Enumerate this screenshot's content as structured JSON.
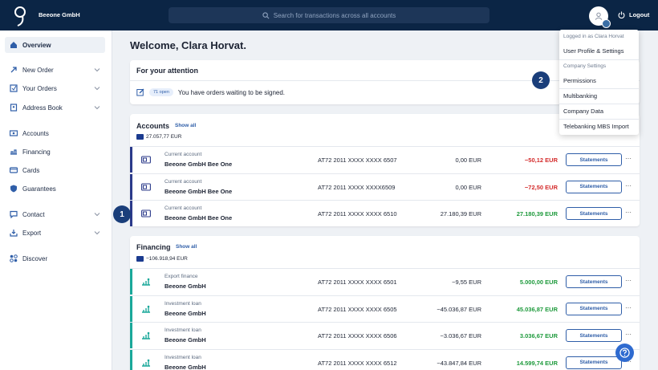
{
  "header": {
    "company": "Beeone GmbH",
    "search_placeholder": "Search for transactions across all accounts",
    "logout": "Logout"
  },
  "sidebar": {
    "items": [
      {
        "label": "Overview",
        "icon": "home-icon"
      },
      {
        "label": "New Order",
        "icon": "arrow-icon"
      },
      {
        "label": "Your Orders",
        "icon": "orders-icon"
      },
      {
        "label": "Address Book",
        "icon": "book-icon"
      },
      {
        "label": "Accounts",
        "icon": "accounts-icon"
      },
      {
        "label": "Financing",
        "icon": "financing-icon"
      },
      {
        "label": "Cards",
        "icon": "cards-icon"
      },
      {
        "label": "Guarantees",
        "icon": "shield-icon"
      },
      {
        "label": "Contact",
        "icon": "chat-icon"
      },
      {
        "label": "Export",
        "icon": "export-icon"
      },
      {
        "label": "Discover",
        "icon": "discover-icon"
      }
    ]
  },
  "main": {
    "welcome": "Welcome, Clara Horvat.",
    "attention": {
      "title": "For your attention",
      "badge": "71 open",
      "text": "You have orders waiting to be signed."
    },
    "accounts": {
      "title": "Accounts",
      "show_all": "Show all",
      "total": "27.057,77 EUR",
      "rows": [
        {
          "type": "Current account",
          "name": "Beeone GmbH Bee One",
          "iban": "AT72 2011 XXXX XXXX 6507",
          "balance": "0,00 EUR",
          "available": "−50,12 EUR",
          "status": "negative",
          "statements": "Statements"
        },
        {
          "type": "Current account",
          "name": "Beeone GmbH Bee One",
          "iban": "AT72 2011 XXXX XXXX6509",
          "balance": "0,00 EUR",
          "available": "−72,50 EUR",
          "status": "negative",
          "statements": "Statements"
        },
        {
          "type": "Current account",
          "name": "Beeone GmbH Bee One",
          "iban": "AT72 2011 XXXX XXXX 6510",
          "balance": "27.180,39 EUR",
          "available": "27.180,39 EUR",
          "status": "positive",
          "statements": "Statements"
        }
      ]
    },
    "financing": {
      "title": "Financing",
      "show_all": "Show all",
      "total": "−106.918,94 EUR",
      "rows": [
        {
          "type": "Export finance",
          "name": "Beeone GmbH",
          "iban": "AT72 2011 XXXX XXXX 6501",
          "balance": "−9,55 EUR",
          "available": "5.000,00 EUR",
          "status": "positive",
          "statements": "Statements"
        },
        {
          "type": "Investment loan",
          "name": "Beeone GmbH",
          "iban": "AT72 2011 XXXX XXXX 6505",
          "balance": "−45.036,87 EUR",
          "available": "45.036,87 EUR",
          "status": "positive",
          "statements": "Statements"
        },
        {
          "type": "Investment loan",
          "name": "Beeone GmbH",
          "iban": "AT72 2011 XXXX XXXX 6506",
          "balance": "−3.036,67 EUR",
          "available": "3.036,67 EUR",
          "status": "positive",
          "statements": "Statements"
        },
        {
          "type": "Investment loan",
          "name": "Beeone GmbH",
          "iban": "AT72 2011 XXXX XXXX 6512",
          "balance": "−43.847,84 EUR",
          "available": "14.599,74 EUR",
          "status": "positive",
          "statements": "Statements"
        }
      ]
    }
  },
  "dropdown": {
    "logged_in": "Logged in as Clara Horvat",
    "profile": "User Profile & Settings",
    "company_settings": "Company Settings",
    "permissions": "Permissions",
    "multibanking": "Multibanking",
    "company_data": "Company Data",
    "telebanking": "Telebanking MBS Import"
  },
  "callouts": {
    "one": "1",
    "two": "2"
  },
  "colors": {
    "navy": "#0b2545",
    "accent": "#2f5ea8",
    "negative": "#d42b2b",
    "positive": "#1e9a3c",
    "accounts_bar": "#2b3a8a",
    "financing_bar": "#1aa89a"
  }
}
